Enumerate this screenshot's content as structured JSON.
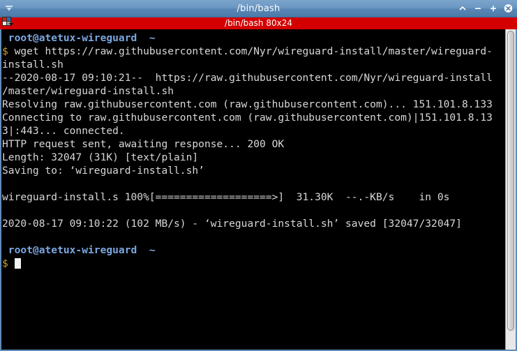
{
  "window": {
    "title": "/bin/bash",
    "menu_icon": "chevron-down-icon",
    "controls": {
      "shade_label": "^",
      "minimize_label": "–",
      "maximize_label": "+",
      "close_label": "✕"
    }
  },
  "tab": {
    "icon": "tab-grid-icon",
    "label": "/bin/bash 80x24"
  },
  "terminal": {
    "colors": {
      "background": "#000000",
      "foreground": "#d8d8d8",
      "prompt": "#7ba6e0",
      "dollar": "#c9a227",
      "cursor": "#f2f2f2",
      "tabbar": "#d40000",
      "titlebar": "#6b97c2",
      "frame_border": "#5f8cba"
    },
    "lines": [
      {
        "type": "prompt",
        "text": "root@atetux-wireguard  ~"
      },
      {
        "type": "command",
        "dollar": "$",
        "text": " wget https://raw.githubusercontent.com/Nyr/wireguard-install/master/wireguard-"
      },
      {
        "type": "output",
        "text": "install.sh"
      },
      {
        "type": "output",
        "text": "--2020-08-17 09:10:21--  https://raw.githubusercontent.com/Nyr/wireguard-install"
      },
      {
        "type": "output",
        "text": "/master/wireguard-install.sh"
      },
      {
        "type": "output",
        "text": "Resolving raw.githubusercontent.com (raw.githubusercontent.com)... 151.101.8.133"
      },
      {
        "type": "output",
        "text": "Connecting to raw.githubusercontent.com (raw.githubusercontent.com)|151.101.8.13"
      },
      {
        "type": "output",
        "text": "3|:443... connected."
      },
      {
        "type": "output",
        "text": "HTTP request sent, awaiting response... 200 OK"
      },
      {
        "type": "output",
        "text": "Length: 32047 (31K) [text/plain]"
      },
      {
        "type": "output",
        "text": "Saving to: ‘wireguard-install.sh’"
      },
      {
        "type": "blank",
        "text": ""
      },
      {
        "type": "output",
        "text": "wireguard-install.s 100%[===================>]  31.30K  --.-KB/s    in 0s"
      },
      {
        "type": "blank",
        "text": ""
      },
      {
        "type": "output",
        "text": "2020-08-17 09:10:22 (102 MB/s) - ‘wireguard-install.sh’ saved [32047/32047]"
      },
      {
        "type": "blank",
        "text": ""
      },
      {
        "type": "prompt",
        "text": "root@atetux-wireguard  ~"
      },
      {
        "type": "cursorline",
        "dollar": "$",
        "text": " "
      }
    ]
  },
  "scrollbar": {
    "name": "vertical-scrollbar"
  }
}
